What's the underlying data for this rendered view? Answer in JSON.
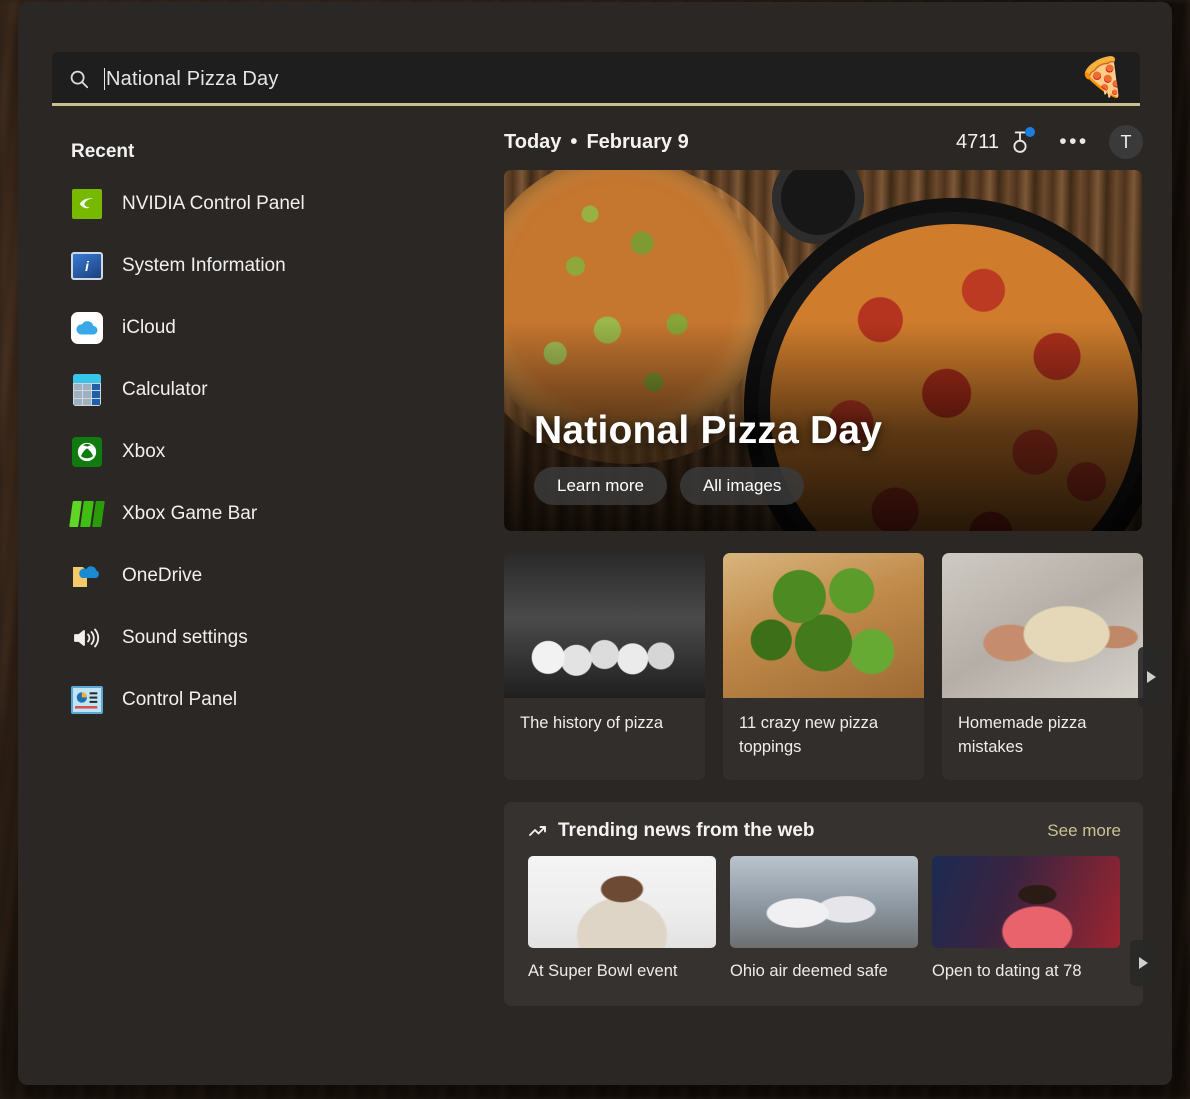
{
  "search": {
    "icon": "search-icon",
    "value": "National Pizza Day",
    "emoji": "🍕",
    "accent_color": "#c9c08c"
  },
  "sidebar": {
    "heading": "Recent",
    "items": [
      {
        "label": "NVIDIA Control Panel",
        "icon": "nvidia-icon"
      },
      {
        "label": "System Information",
        "icon": "system-information-icon"
      },
      {
        "label": "iCloud",
        "icon": "icloud-icon"
      },
      {
        "label": "Calculator",
        "icon": "calculator-icon"
      },
      {
        "label": "Xbox",
        "icon": "xbox-icon"
      },
      {
        "label": "Xbox Game Bar",
        "icon": "xbox-game-bar-icon"
      },
      {
        "label": "OneDrive",
        "icon": "onedrive-icon"
      },
      {
        "label": "Sound settings",
        "icon": "speaker-icon"
      },
      {
        "label": "Control Panel",
        "icon": "control-panel-icon"
      }
    ]
  },
  "header": {
    "today": "Today",
    "separator": "•",
    "date": "February 9",
    "points": "4711",
    "medal_icon": "rewards-medal-icon",
    "more_label": "•••",
    "avatar_initial": "T"
  },
  "hero": {
    "title": "National Pizza Day",
    "buttons": [
      {
        "label": "Learn more"
      },
      {
        "label": "All images"
      }
    ]
  },
  "cards": [
    {
      "title": "The history of pizza",
      "thumb": "historic-pizzeria-photo"
    },
    {
      "title": "11 crazy new pizza toppings",
      "thumb": "green-topping-pizza-photo"
    },
    {
      "title": "Homemade pizza mistakes",
      "thumb": "kneading-dough-photo"
    }
  ],
  "trending": {
    "icon": "trending-up-icon",
    "title": "Trending news from the web",
    "see_more": "See more",
    "see_more_color": "#cbc292",
    "items": [
      {
        "title": "At Super Bowl event",
        "thumb": "woman-at-event-photo"
      },
      {
        "title": "Ohio air deemed safe",
        "thumb": "hazmat-workers-photo"
      },
      {
        "title": "Open to dating at 78",
        "thumb": "singer-performing-photo"
      }
    ]
  },
  "carousel": {
    "next_label": "▶"
  }
}
